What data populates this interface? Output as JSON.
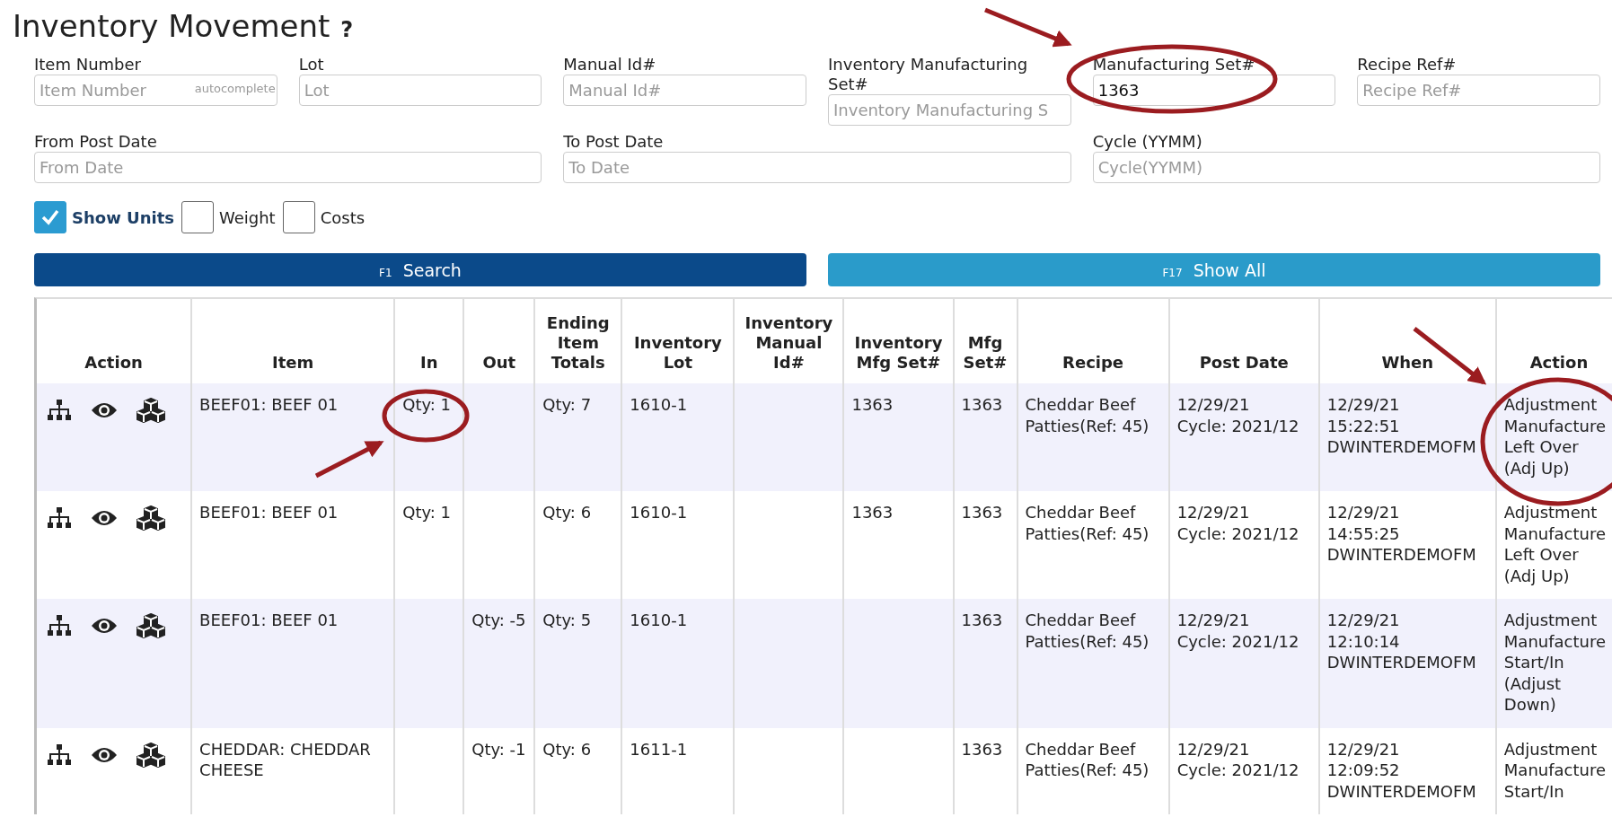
{
  "page": {
    "title": "Inventory Movement",
    "help": "?"
  },
  "filter_rows": [
    [
      {
        "label": "Item Number",
        "placeholder": "Item Number",
        "hint": "autocomplete"
      },
      {
        "label": "Lot",
        "placeholder": "Lot"
      },
      {
        "label": "Manual Id#",
        "placeholder": "Manual Id#"
      },
      {
        "label": "Inventory Manufacturing Set#",
        "placeholder": "Inventory Manufacturing S"
      },
      {
        "label": "Manufacturing Set#",
        "value": "1363"
      },
      {
        "label": "Recipe Ref#",
        "placeholder": "Recipe Ref#"
      }
    ],
    [
      {
        "label": "From Post Date",
        "placeholder": "From Date"
      },
      {
        "label": "To Post Date",
        "placeholder": "To Date"
      },
      {
        "label": "Cycle (YYMM)",
        "placeholder": "Cycle(YYMM)"
      }
    ]
  ],
  "options": [
    {
      "label": "Show Units",
      "checked": true
    },
    {
      "label": "Weight",
      "checked": false
    },
    {
      "label": "Costs",
      "checked": false
    }
  ],
  "buttons": [
    {
      "key": "F1",
      "label": "Search",
      "kind": "primary"
    },
    {
      "key": "F17",
      "label": "Show All",
      "kind": "secondary"
    }
  ],
  "table": {
    "columns": [
      "Action",
      "Item",
      "In",
      "Out",
      "Ending Item Totals",
      "Inventory Lot",
      "Inventory Manual Id#",
      "Inventory Mfg Set#",
      "Mfg Set#",
      "Recipe",
      "Post Date",
      "When",
      "Action"
    ],
    "rows": [
      {
        "cells": [
          "",
          "BEEF01: BEEF 01",
          "Qty: 1",
          "",
          "Qty: 7",
          "1610-1",
          "",
          "1363",
          "1363",
          "Cheddar Beef\nPatties(Ref: 45)",
          "12/29/21\nCycle: 2021/12",
          "12/29/21\n15:22:51\nDWINTERDEMOFM",
          "Adjustment\nManufacture\nLeft Over\n(Adj Up)"
        ]
      },
      {
        "cells": [
          "",
          "BEEF01: BEEF 01",
          "Qty: 1",
          "",
          "Qty: 6",
          "1610-1",
          "",
          "1363",
          "1363",
          "Cheddar Beef\nPatties(Ref: 45)",
          "12/29/21\nCycle: 2021/12",
          "12/29/21\n14:55:25\nDWINTERDEMOFM",
          "Adjustment\nManufacture\nLeft Over\n(Adj Up)"
        ]
      },
      {
        "cells": [
          "",
          "BEEF01: BEEF 01",
          "",
          "Qty: -5",
          "Qty: 5",
          "1610-1",
          "",
          "",
          "1363",
          "Cheddar Beef\nPatties(Ref: 45)",
          "12/29/21\nCycle: 2021/12",
          "12/29/21\n12:10:14\nDWINTERDEMOFM",
          "Adjustment\nManufacture\nStart/In\n(Adjust\nDown)"
        ]
      },
      {
        "cells": [
          "",
          "CHEDDAR: CHEDDAR\nCHEESE",
          "",
          "Qty: -1",
          "Qty: 6",
          "1611-1",
          "",
          "",
          "1363",
          "Cheddar Beef\nPatties(Ref: 45)",
          "12/29/21\nCycle: 2021/12",
          "12/29/21\n12:09:52\nDWINTERDEMOFM",
          "Adjustment\nManufacture\nStart/In"
        ]
      }
    ]
  }
}
